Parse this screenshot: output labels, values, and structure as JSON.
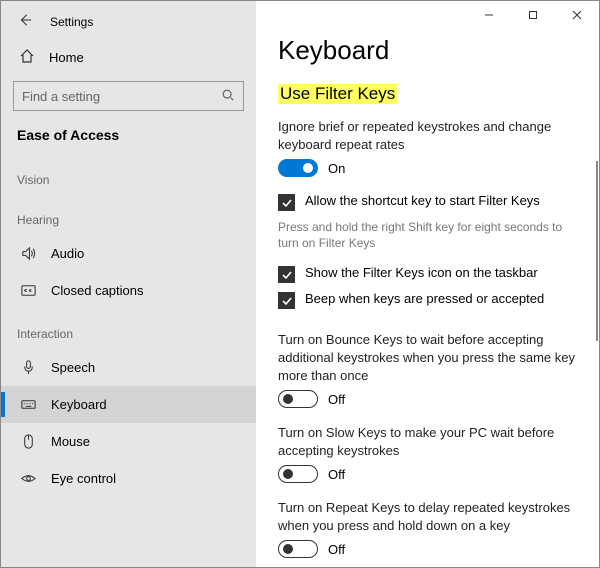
{
  "titlebar": {
    "app_name": "Settings"
  },
  "sidebar": {
    "home_label": "Home",
    "search_placeholder": "Find a setting",
    "ease_label": "Ease of Access",
    "groups": {
      "vision": "Vision",
      "hearing": "Hearing",
      "interaction": "Interaction"
    },
    "items": {
      "audio": "Audio",
      "cc": "Closed captions",
      "speech": "Speech",
      "keyboard": "Keyboard",
      "mouse": "Mouse",
      "eye": "Eye control"
    }
  },
  "page": {
    "title": "Keyboard",
    "section_title": "Use Filter Keys",
    "ignore_desc": "Ignore brief or repeated keystrokes and change keyboard repeat rates",
    "filter_on_label": "On",
    "shortcut_check": "Allow the shortcut key to start Filter Keys",
    "shortcut_sub": "Press and hold the right Shift key for eight seconds to turn on Filter Keys",
    "taskbar_check": "Show the Filter Keys icon on the taskbar",
    "beep_check": "Beep when keys are pressed or accepted",
    "bounce_desc": "Turn on Bounce Keys to wait before accepting additional keystrokes when you press the same key more than once",
    "bounce_label": "Off",
    "slow_desc": "Turn on Slow Keys to make your PC wait before accepting keystrokes",
    "slow_label": "Off",
    "repeat_desc": "Turn on Repeat Keys to delay repeated keystrokes when you press and hold down on a key",
    "repeat_label": "Off"
  }
}
